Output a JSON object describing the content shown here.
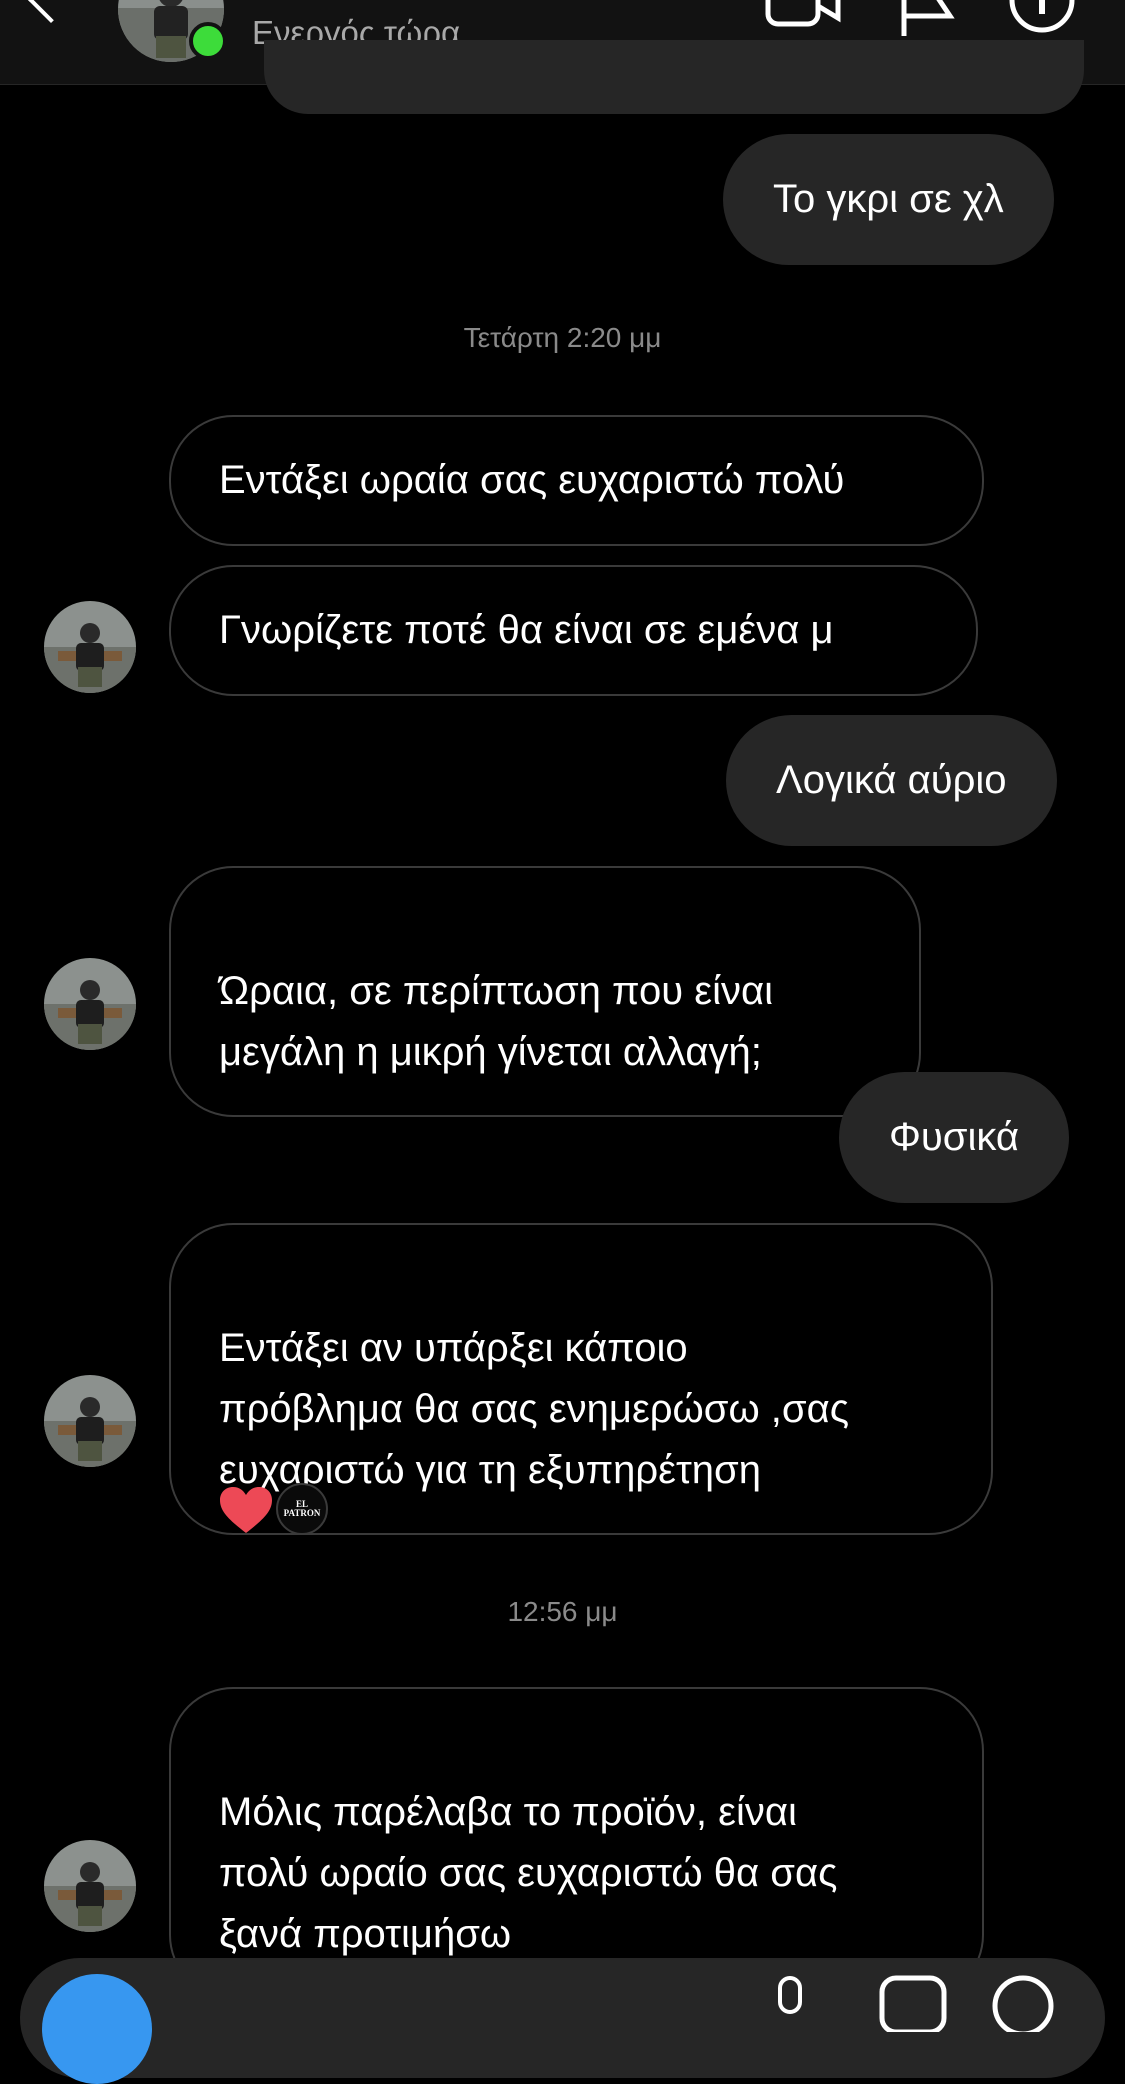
{
  "header": {
    "status": "Ενεργός τώρα",
    "icons": [
      "back-chevron-icon",
      "video-call-icon",
      "flag-icon",
      "info-icon"
    ]
  },
  "messages": [
    {
      "id": "m1",
      "direction": "outgoing",
      "text": "Το γκρι σε χλ"
    },
    {
      "id": "ts1",
      "type": "timestamp",
      "text": "Τετάρτη 2:20 μμ"
    },
    {
      "id": "m2",
      "direction": "incoming",
      "text": "Εντάξει ωραία σας ευχαριστώ πολύ"
    },
    {
      "id": "m3",
      "direction": "incoming",
      "text": "Γνωρίζετε ποτέ θα είναι σε εμένα μ"
    },
    {
      "id": "m4",
      "direction": "outgoing",
      "text": "Λογικά αύριο"
    },
    {
      "id": "m5",
      "direction": "incoming",
      "text": "Ώραια, σε περίπτωση που είναι\nμεγάλη η μικρή γίνεται αλλαγή;"
    },
    {
      "id": "m6",
      "direction": "outgoing",
      "text": "Φυσικά"
    },
    {
      "id": "m7",
      "direction": "incoming",
      "text": "Εντάξει αν υπάρξει κάποιο\nπρόβλημα θα σας ενημερώσω ,σας\nευχαριστώ για τη  εξυπηρέτηση"
    },
    {
      "id": "ts2",
      "type": "timestamp",
      "text": "12:56 μμ"
    },
    {
      "id": "m8",
      "direction": "incoming",
      "text": "Μόλις παρέλαβα το προϊόν, είναι\nπολύ ωραίο σας ευχαριστώ θα σας\nξανά  προτιμήσω"
    }
  ],
  "reaction": {
    "emoji": "heart-icon",
    "reactor_badge": "EL PATRON"
  },
  "composer": {
    "icons": [
      "camera-icon",
      "mic-icon",
      "gallery-icon",
      "sticker-icon"
    ]
  },
  "colors": {
    "background": "#000000",
    "header": "#121212",
    "outgoing_bubble": "#262626",
    "incoming_border": "#3a3a3a",
    "online": "#3ddc3a",
    "heart": "#ed4956",
    "accent": "#3797f0"
  }
}
